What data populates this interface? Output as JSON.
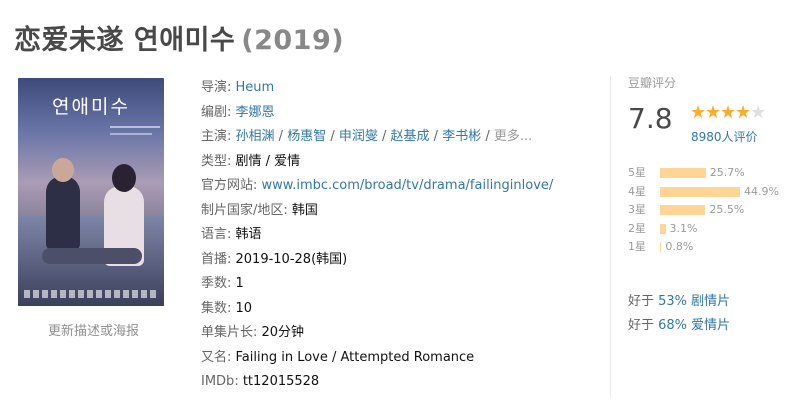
{
  "header": {
    "title": "恋爱未遂 연애미수",
    "year": "(2019)"
  },
  "poster": {
    "title_text": "연애미수"
  },
  "update_link": "更新描述或海报",
  "info": {
    "director_label": "导演: ",
    "director": "Heum",
    "writer_label": "编剧: ",
    "writer": "李娜恩",
    "cast_label": "主演: ",
    "cast": [
      "孙相渊",
      "杨惠智",
      "申润燮",
      "赵基成",
      "李书彬"
    ],
    "cast_sep": " / ",
    "cast_more": "更多...",
    "genre_label": "类型: ",
    "genre": "剧情 / 爱情",
    "website_label": "官方网站: ",
    "website": "www.imbc.com/broad/tv/drama/failinginlove/",
    "country_label": "制片国家/地区: ",
    "country": "韩国",
    "language_label": "语言: ",
    "language": "韩语",
    "premiere_label": "首播: ",
    "premiere": "2019-10-28(韩国)",
    "seasons_label": "季数: ",
    "seasons": "1",
    "episodes_label": "集数: ",
    "episodes": "10",
    "runtime_label": "单集片长: ",
    "runtime": "20分钟",
    "aka_label": "又名: ",
    "aka": "Failing in Love / Attempted Romance",
    "imdb_label": "IMDb: ",
    "imdb": "tt12015528"
  },
  "rating": {
    "label": "豆瓣评分",
    "score": "7.8",
    "stars_value": 4,
    "votes": "8980人评价",
    "star_color": "#ffac2d",
    "bar_color": "#ffd596",
    "distribution": [
      {
        "label": "5星",
        "pct_text": "25.7%",
        "pct": 25.7
      },
      {
        "label": "4星",
        "pct_text": "44.9%",
        "pct": 44.9
      },
      {
        "label": "3星",
        "pct_text": "25.5%",
        "pct": 25.5
      },
      {
        "label": "2星",
        "pct_text": "3.1%",
        "pct": 3.1
      },
      {
        "label": "1星",
        "pct_text": "0.8%",
        "pct": 0.8
      }
    ],
    "better_than": [
      {
        "prefix": "好于 ",
        "link": "53% 剧情片"
      },
      {
        "prefix": "好于 ",
        "link": "68% 爱情片"
      }
    ]
  }
}
